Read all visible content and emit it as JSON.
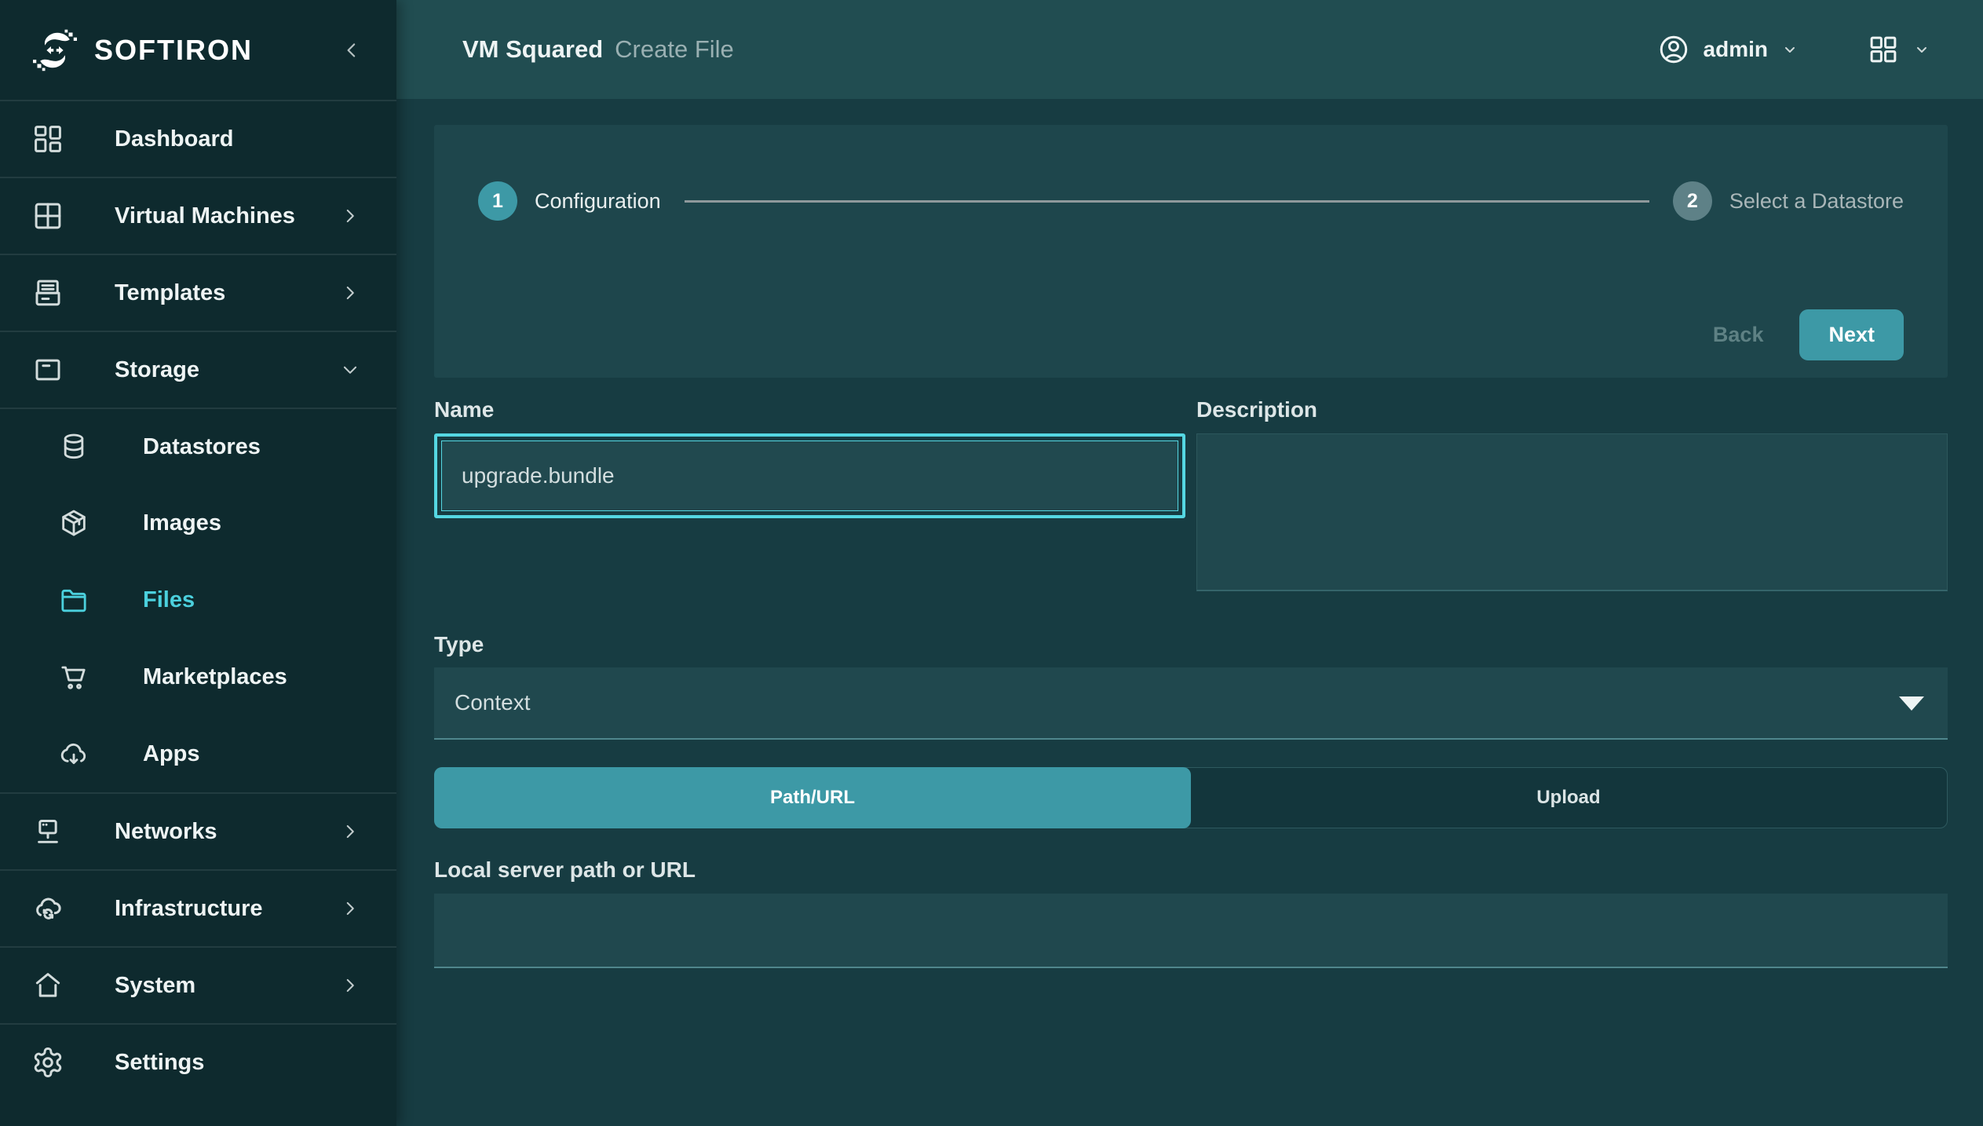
{
  "app": {
    "brand": "SOFTIRON"
  },
  "header": {
    "product": "VM Squared",
    "page_title": "Create File",
    "user": "admin"
  },
  "sidebar": {
    "items": [
      {
        "label": "Dashboard"
      },
      {
        "label": "Virtual Machines"
      },
      {
        "label": "Templates"
      },
      {
        "label": "Storage"
      },
      {
        "label": "Datastores"
      },
      {
        "label": "Images"
      },
      {
        "label": "Files"
      },
      {
        "label": "Marketplaces"
      },
      {
        "label": "Apps"
      },
      {
        "label": "Networks"
      },
      {
        "label": "Infrastructure"
      },
      {
        "label": "System"
      },
      {
        "label": "Settings"
      }
    ],
    "active_item": "Files"
  },
  "wizard": {
    "steps": [
      {
        "number": "1",
        "label": "Configuration",
        "state": "current"
      },
      {
        "number": "2",
        "label": "Select a Datastore",
        "state": "upcoming"
      }
    ],
    "back": "Back",
    "next": "Next"
  },
  "form": {
    "name": {
      "label": "Name",
      "value": "upgrade.bundle"
    },
    "description": {
      "label": "Description",
      "value": ""
    },
    "type": {
      "label": "Type",
      "value": "Context"
    },
    "source_tabs": [
      {
        "label": "Path/URL",
        "active": true
      },
      {
        "label": "Upload",
        "active": false
      }
    ],
    "path": {
      "label": "Local server path or URL",
      "value": ""
    }
  },
  "colors": {
    "accent_teal": "#3D99A6",
    "highlight_cyan": "#4BD0DD",
    "focus_cyan": "#55D7E2",
    "step_upcoming": "#5E8187",
    "header_bg": "#214D51",
    "sidebar_bg": "#0E2A2E"
  }
}
